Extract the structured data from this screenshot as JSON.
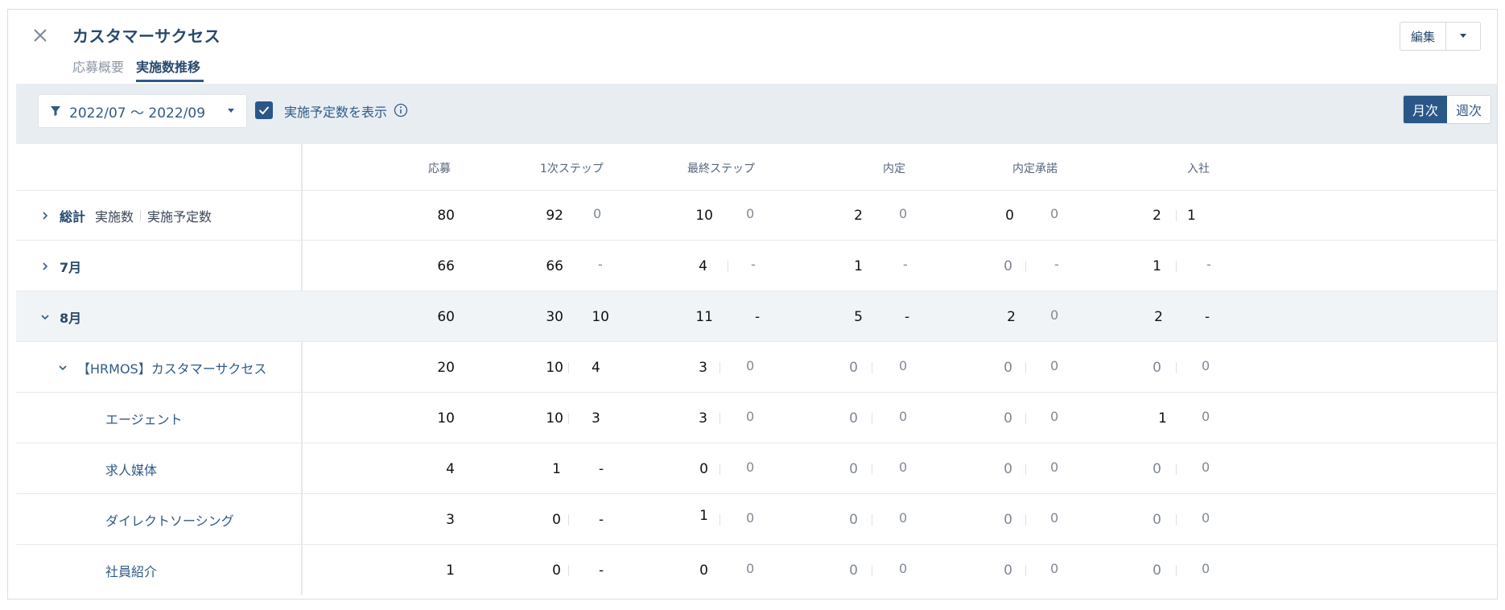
{
  "header": {
    "title": "カスタマーサクセス",
    "tabs": [
      "応募概要",
      "実施数推移"
    ],
    "active_tab": "実施数推移",
    "edit_label": "編集"
  },
  "toolbar": {
    "period": "2022/07 〜 2022/09",
    "checkbox_label": "実施予定数を表示",
    "checkbox_checked": true,
    "toggle": [
      "月次",
      "週次"
    ],
    "toggle_active": "月次"
  },
  "table": {
    "columns": [
      "応募",
      "1次ステップ",
      "最終ステップ",
      "内定",
      "内定承諾",
      "入社"
    ],
    "rows": [
      {
        "label": "総計",
        "label_sub1": "実施数",
        "label_sub2": "実施予定数",
        "values": [
          "80",
          "92",
          "0",
          "10",
          "0",
          "2",
          "0",
          "0",
          "0",
          "2",
          "1"
        ]
      },
      {
        "label": "7月",
        "values": [
          "66",
          "66",
          "-",
          "4",
          "-",
          "1",
          "-",
          "0",
          "-",
          "1",
          "-"
        ]
      },
      {
        "label": "8月",
        "values": [
          "60",
          "30",
          "10",
          "11",
          "-",
          "5",
          "-",
          "2",
          "0",
          "2",
          "-"
        ]
      },
      {
        "label": "【HRMOS】カスタマーサクセス",
        "values": [
          "20",
          "10",
          "4",
          "3",
          "0",
          "0",
          "0",
          "0",
          "0",
          "0",
          "0"
        ]
      },
      {
        "label": "エージェント",
        "values": [
          "10",
          "10",
          "3",
          "3",
          "0",
          "0",
          "0",
          "0",
          "0",
          "1",
          "0"
        ]
      },
      {
        "label": "求人媒体",
        "values": [
          "4",
          "1",
          "-",
          "0",
          "0",
          "0",
          "0",
          "0",
          "0",
          "0",
          "0"
        ]
      },
      {
        "label": "ダイレクトソーシング",
        "values": [
          "3",
          "0",
          "-",
          "1",
          "0",
          "0",
          "0",
          "0",
          "0",
          "0",
          "0"
        ]
      },
      {
        "label": "社員紹介",
        "values": [
          "1",
          "0",
          "-",
          "0",
          "0",
          "0",
          "0",
          "0",
          "0",
          "0",
          "0"
        ]
      }
    ]
  },
  "colors": {
    "accent": "#2a5787",
    "title": "#27496d",
    "toolbar_bg": "#e8edf2",
    "row_highlight": "#f1f4f7"
  }
}
